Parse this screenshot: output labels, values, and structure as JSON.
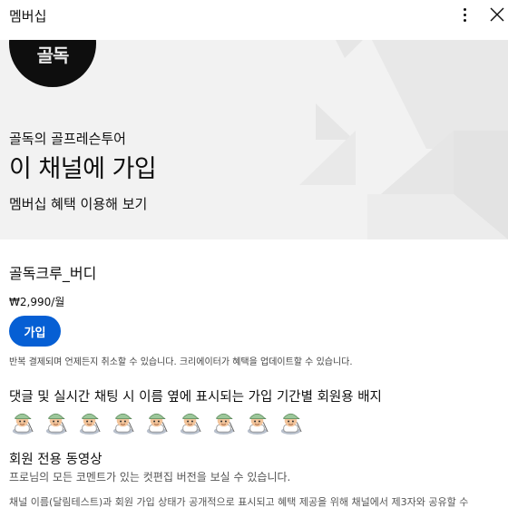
{
  "dialog": {
    "title": "멤버십",
    "more_icon": "more-vert-icon",
    "close_icon": "close-icon"
  },
  "hero": {
    "avatar_text": "골독",
    "channel_name": "골독의 골프레슨투어",
    "title": "이 채널에 가입",
    "subtitle": "멤버십 혜택 이용해 보기"
  },
  "tier": {
    "name": "골독크루_버디",
    "price": "₩2,990/월",
    "join_label": "가입",
    "billing_note": "반복 결제되며 언제든지 취소할 수 있습니다. 크리에이터가 혜택을 업데이트할 수 있습니다."
  },
  "perks": [
    {
      "title": "댓글 및 실시간 채팅 시 이름 옆에 표시되는 가입 기간별 회원용 배지"
    },
    {
      "title": "회원 전용 동영상",
      "desc": "프로님의 모든 코멘트가 있는 컷편집 버전을 보실 수 있습니다."
    }
  ],
  "badges": [
    "golfer-badge-icon",
    "golfer-badge-icon",
    "golfer-badge-icon",
    "golfer-badge-icon",
    "golfer-badge-icon",
    "golfer-badge-icon",
    "golfer-badge-icon",
    "golfer-badge-icon",
    "golfer-badge-icon"
  ],
  "privacy_note": "채널 이름(달림테스트)과 회원 가입 상태가 공개적으로 표시되고 혜택 제공을 위해 채널에서 제3자와 공유할 수",
  "colors": {
    "accent": "#065fd4",
    "hero_bg": "#f2f2f2"
  }
}
